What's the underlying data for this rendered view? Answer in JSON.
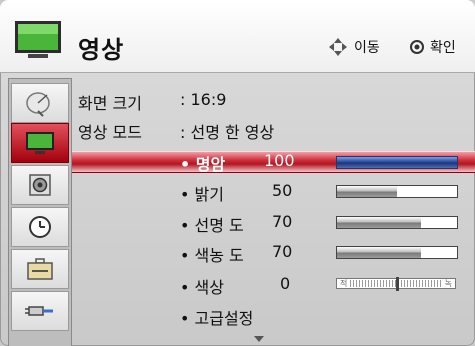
{
  "header": {
    "title": "영상",
    "move_hint": "이동",
    "ok_hint": "확인"
  },
  "sidebar": {
    "items": [
      {
        "icon": "satellite-dish-icon"
      },
      {
        "icon": "tv-monitor-icon",
        "active": true
      },
      {
        "icon": "speaker-icon"
      },
      {
        "icon": "clock-icon"
      },
      {
        "icon": "toolbox-icon"
      },
      {
        "icon": "plug-connector-icon"
      }
    ]
  },
  "settings": {
    "screen_size_label": "화면 크기",
    "screen_size_value": ": 16:9",
    "picture_mode_label": "영상 모드",
    "picture_mode_value": ": 선명 한 영상"
  },
  "adjustments": [
    {
      "label": "• 명암",
      "value": "100",
      "level": 100,
      "selected": true
    },
    {
      "label": "• 밝기",
      "value": "50",
      "level": 50
    },
    {
      "label": "• 선명 도",
      "value": "70",
      "level": 70
    },
    {
      "label": "• 색농 도",
      "value": "70",
      "level": 70
    },
    {
      "label": "• 색상",
      "value": "0",
      "tint_left": "적",
      "tint_right": "녹",
      "tint_position": 0.5
    },
    {
      "label": "• 고급설정"
    }
  ],
  "colors": {
    "highlight": "#c0202e",
    "active_sidebar": "#b0101c",
    "selected_slider": "#2b4a98"
  }
}
